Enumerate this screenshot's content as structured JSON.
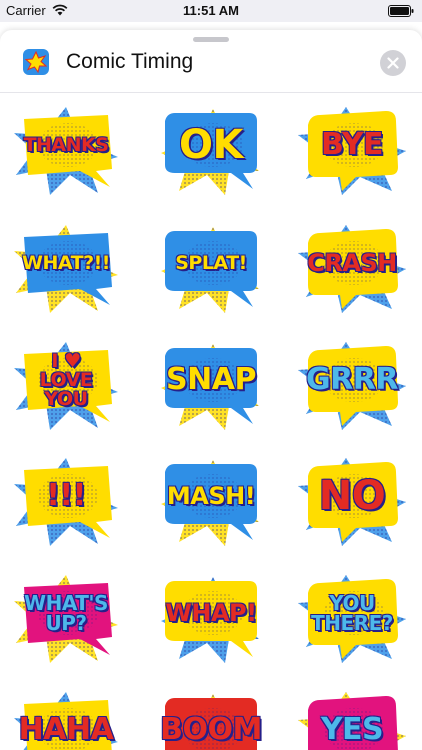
{
  "status_bar": {
    "carrier": "Carrier",
    "time": "11:51 AM",
    "wifi_icon": "wifi-icon",
    "battery_icon": "battery-icon"
  },
  "header": {
    "app_icon": "comic-burst-icon",
    "title": "Comic Timing",
    "close_icon": "close-icon"
  },
  "colors": {
    "yellow": "#ffdd00",
    "blue": "#2f8fe6",
    "magenta": "#e2137e",
    "red": "#e32b23",
    "navy": "#26208a",
    "light_blue": "#4db8ea"
  },
  "stickers": [
    {
      "text": "THANKS",
      "bubble": "yellow"
    },
    {
      "text": "OK",
      "bubble": "blue"
    },
    {
      "text": "BYE",
      "bubble": "yellow"
    },
    {
      "text": "WHAT?!!",
      "bubble": "blue"
    },
    {
      "text": "SPLAT!",
      "bubble": "blue"
    },
    {
      "text": "CRASH",
      "bubble": "yellow"
    },
    {
      "text": "I ♥ LOVE YOU",
      "lines": [
        "I ♥",
        "LOVE",
        "YOU"
      ],
      "bubble": "yellow"
    },
    {
      "text": "SNAP",
      "bubble": "blue"
    },
    {
      "text": "GRRR",
      "bubble": "yellow"
    },
    {
      "text": "!!!",
      "bubble": "yellow"
    },
    {
      "text": "MASH!",
      "bubble": "blue"
    },
    {
      "text": "NO",
      "bubble": "yellow"
    },
    {
      "text": "WHAT'S UP?",
      "lines": [
        "WHAT'S",
        "UP?"
      ],
      "bubble": "magenta"
    },
    {
      "text": "WHAP!",
      "bubble": "yellow"
    },
    {
      "text": "YOU THERE?",
      "lines": [
        "YOU",
        "THERE?"
      ],
      "bubble": "yellow"
    },
    {
      "text": "HAHA",
      "bubble": "yellow"
    },
    {
      "text": "BOOM",
      "bubble": "red"
    },
    {
      "text": "YES",
      "bubble": "magenta"
    }
  ]
}
